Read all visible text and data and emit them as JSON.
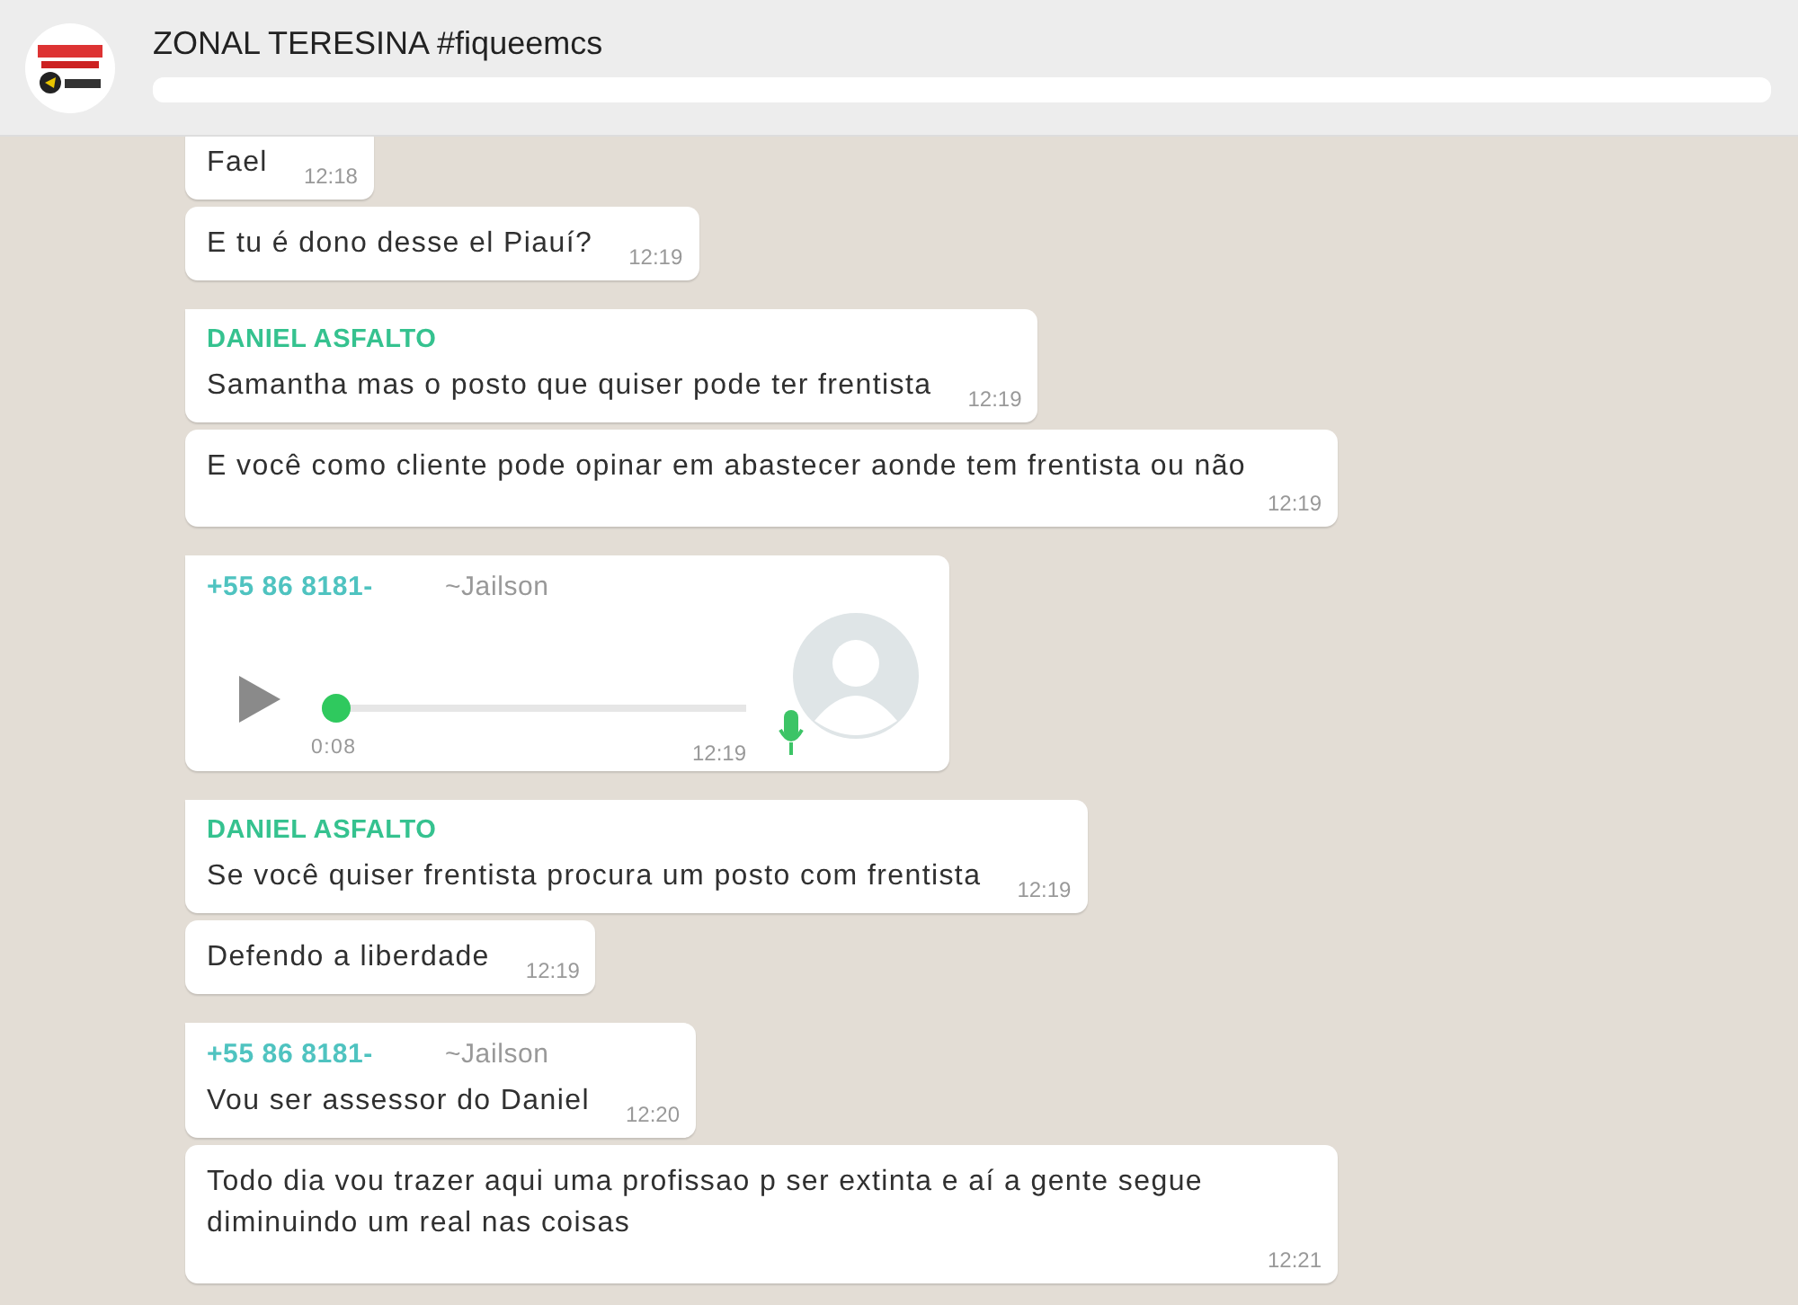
{
  "chat": {
    "title": "ZONAL TERESINA #fiqueemcs"
  },
  "messages": [
    {
      "kind": "text",
      "text": "Fael",
      "time": "12:18"
    },
    {
      "kind": "text",
      "group_start": false,
      "text": "E tu é dono desse el Piauí?",
      "time": "12:19"
    },
    {
      "kind": "text",
      "group_start": true,
      "sender": {
        "name": "DANIEL ASFALTO",
        "color": "#35c28f"
      },
      "text": "Samantha mas o posto que quiser pode ter frentista",
      "time": "12:19"
    },
    {
      "kind": "text",
      "group_start": false,
      "text": "E você como cliente pode opinar em abastecer aonde tem frentista ou não",
      "time": "12:19"
    },
    {
      "kind": "voice",
      "group_start": true,
      "sender": {
        "phone": "+55 86 8181-",
        "name": "~Jailson",
        "color": "#4fc3c0"
      },
      "duration": "0:08",
      "level": 0,
      "time": "12:19"
    },
    {
      "kind": "text",
      "group_start": true,
      "sender": {
        "name": "DANIEL ASFALTO",
        "color": "#35c28f"
      },
      "text": "Se você quiser frentista procura um posto com frentista",
      "time": "12:19"
    },
    {
      "kind": "text",
      "group_start": false,
      "text": "Defendo a liberdade",
      "time": "12:19"
    },
    {
      "kind": "text",
      "group_start": true,
      "sender": {
        "phone": "+55 86 8181-",
        "name": "~Jailson",
        "color": "#4fc3c0"
      },
      "text": "Vou ser assessor do Daniel",
      "time": "12:20"
    },
    {
      "kind": "text",
      "group_start": false,
      "text": "Todo dia vou trazer aqui uma profissao p ser extinta e aí a gente segue diminuindo um real nas coisas",
      "time": "12:21"
    }
  ]
}
